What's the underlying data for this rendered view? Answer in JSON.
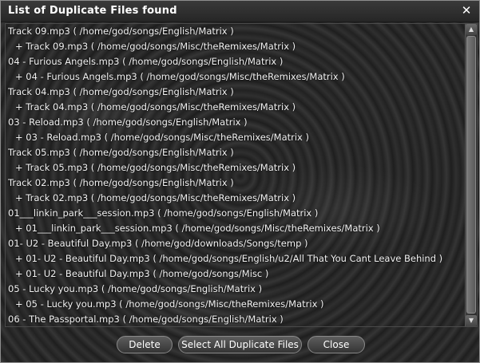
{
  "window": {
    "title": "List of Duplicate Files found",
    "close_glyph": "✕"
  },
  "list": {
    "rows": [
      {
        "text": "Track 09.mp3  ( /home/god/songs/English/Matrix )",
        "child": false
      },
      {
        "text": "+ Track 09.mp3  ( /home/god/songs/Misc/theRemixes/Matrix )",
        "child": true
      },
      {
        "text": "04 - Furious Angels.mp3  ( /home/god/songs/English/Matrix )",
        "child": false
      },
      {
        "text": "+ 04 - Furious Angels.mp3  ( /home/god/songs/Misc/theRemixes/Matrix )",
        "child": true
      },
      {
        "text": "Track 04.mp3  ( /home/god/songs/English/Matrix )",
        "child": false
      },
      {
        "text": "+ Track 04.mp3  ( /home/god/songs/Misc/theRemixes/Matrix )",
        "child": true
      },
      {
        "text": "03 - Reload.mp3  ( /home/god/songs/English/Matrix )",
        "child": false
      },
      {
        "text": "+ 03 - Reload.mp3  ( /home/god/songs/Misc/theRemixes/Matrix )",
        "child": true
      },
      {
        "text": "Track 05.mp3  ( /home/god/songs/English/Matrix )",
        "child": false
      },
      {
        "text": "+ Track 05.mp3  ( /home/god/songs/Misc/theRemixes/Matrix )",
        "child": true
      },
      {
        "text": "Track 02.mp3  ( /home/god/songs/English/Matrix )",
        "child": false
      },
      {
        "text": "+ Track 02.mp3  ( /home/god/songs/Misc/theRemixes/Matrix )",
        "child": true
      },
      {
        "text": "01___linkin_park___session.mp3  ( /home/god/songs/English/Matrix )",
        "child": false
      },
      {
        "text": "+ 01___linkin_park___session.mp3  ( /home/god/songs/Misc/theRemixes/Matrix )",
        "child": true
      },
      {
        "text": "01- U2 - Beautiful Day.mp3  ( /home/god/downloads/Songs/temp )",
        "child": false
      },
      {
        "text": "+ 01- U2 - Beautiful Day.mp3  ( /home/god/songs/English/u2/All That You Cant Leave Behind )",
        "child": true
      },
      {
        "text": "+ 01- U2 - Beautiful Day.mp3  ( /home/god/songs/Misc )",
        "child": true
      },
      {
        "text": "05 - Lucky you.mp3  ( /home/god/songs/English/Matrix )",
        "child": false
      },
      {
        "text": "+ 05 - Lucky you.mp3  ( /home/god/songs/Misc/theRemixes/Matrix )",
        "child": true
      },
      {
        "text": "06 - The Passportal.mp3  ( /home/god/songs/English/Matrix )",
        "child": false
      }
    ]
  },
  "scrollbar": {
    "up_glyph": "▲",
    "down_glyph": "▼"
  },
  "buttons": {
    "delete": "Delete",
    "select_all": "Select All Duplicate Files",
    "close": "Close"
  }
}
